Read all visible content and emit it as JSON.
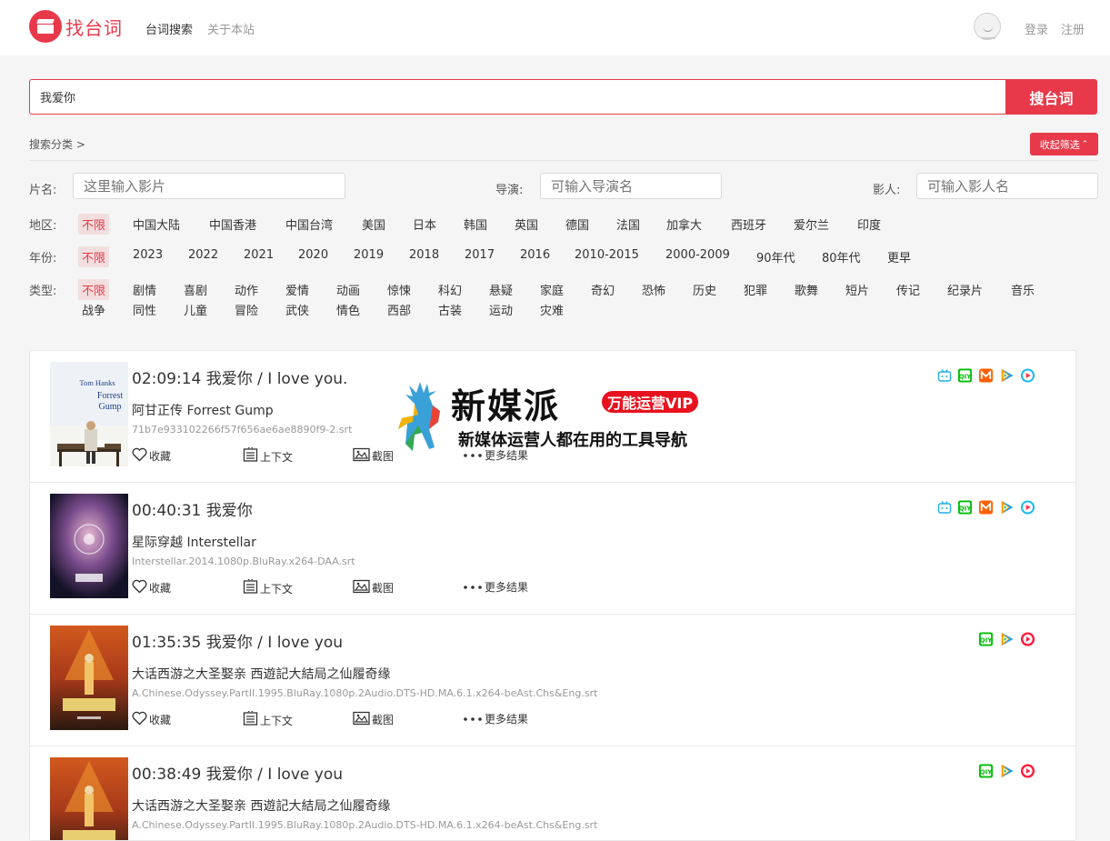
{
  "header": {
    "logo_text": "找台词",
    "nav": [
      {
        "label": "台词搜索",
        "active": true
      },
      {
        "label": "关于本站",
        "active": false
      }
    ],
    "login": "登录",
    "register": "注册"
  },
  "search": {
    "value": "我爱你",
    "button": "搜台词"
  },
  "filters": {
    "breadcrumb": "搜索分类 >",
    "collapse_label": "收起筛选",
    "title_label": "片名:",
    "title_placeholder": "这里输入影片",
    "director_label": "导演:",
    "director_placeholder": "可输入导演名",
    "cast_label": "影人:",
    "cast_placeholder": "可输入影人名",
    "region_label": "地区:",
    "regions": [
      "不限",
      "中国大陆",
      "中国香港",
      "中国台湾",
      "美国",
      "日本",
      "韩国",
      "英国",
      "德国",
      "法国",
      "加拿大",
      "西班牙",
      "爱尔兰",
      "印度"
    ],
    "year_label": "年份:",
    "years": [
      "不限",
      "2023",
      "2022",
      "2021",
      "2020",
      "2019",
      "2018",
      "2017",
      "2016",
      "2010-2015",
      "2000-2009",
      "90年代",
      "80年代",
      "更早"
    ],
    "genre_label": "类型:",
    "genres_row1": [
      "不限",
      "剧情",
      "喜剧",
      "动作",
      "爱情",
      "动画",
      "惊悚",
      "科幻",
      "悬疑",
      "家庭",
      "奇幻",
      "恐怖",
      "历史",
      "犯罪",
      "歌舞",
      "短片",
      "传记",
      "纪录片",
      "音乐"
    ],
    "genres_row2": [
      "战争",
      "同性",
      "儿童",
      "冒险",
      "武侠",
      "情色",
      "西部",
      "古装",
      "运动",
      "灾难"
    ]
  },
  "results": [
    {
      "time_title": "02:09:14 我爱你 / I love you.",
      "movie": "阿甘正传 Forrest Gump",
      "file": "71b7e933102266f57f656ae6ae8890f9-2.srt",
      "platforms": [
        "bilibili-icon",
        "iqiyi-icon",
        "mgtv-icon",
        "tencent-video-icon",
        "youku-icon"
      ],
      "poster": "forrest"
    },
    {
      "time_title": "00:40:31 我爱你",
      "movie": "星际穿越 Interstellar",
      "file": "Interstellar.2014.1080p.BluRay.x264-DAA.srt",
      "platforms": [
        "bilibili-icon",
        "iqiyi-icon",
        "mgtv-icon",
        "tencent-video-icon",
        "youku-icon"
      ],
      "poster": "interstellar"
    },
    {
      "time_title": "01:35:35 我爱你 / I love you",
      "movie": "大话西游之大圣娶亲 西遊記大結局之仙履奇缘",
      "file": "A.Chinese.Odyssey.PartII.1995.BluRay.1080p.2Audio.DTS-HD.MA.6.1.x264-beAst.Chs&Eng.srt",
      "platforms": [
        "iqiyi-icon",
        "tencent-video-icon",
        "youku-red-icon"
      ],
      "poster": "odyssey"
    },
    {
      "time_title": "00:38:49 我爱你 / I love you",
      "movie": "大话西游之大圣娶亲 西遊記大結局之仙履奇缘",
      "file": "A.Chinese.Odyssey.PartII.1995.BluRay.1080p.2Audio.DTS-HD.MA.6.1.x264-beAst.Chs&Eng.srt",
      "platforms": [
        "iqiyi-icon",
        "tencent-video-icon",
        "youku-red-icon"
      ],
      "poster": "odyssey"
    }
  ],
  "actions": {
    "favorite": "收藏",
    "context": "上下文",
    "screenshot": "截图",
    "more": "更多结果"
  },
  "overlay": {
    "title": "新媒派",
    "badge": "万能运营VIP",
    "subtitle": "新媒体运营人都在用的工具导航"
  },
  "colors": {
    "accent": "#e8394a"
  }
}
